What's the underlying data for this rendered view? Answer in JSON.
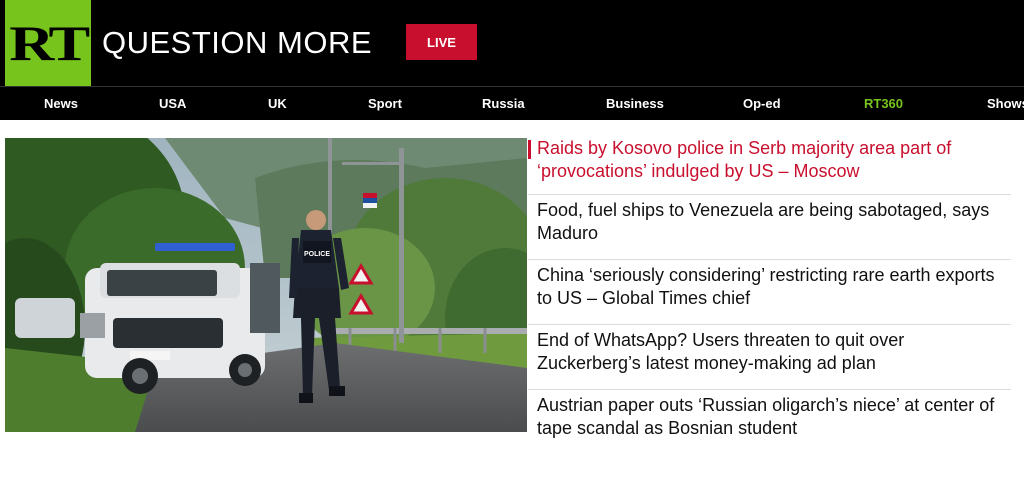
{
  "header": {
    "logo_text": "RT",
    "slogan": "QUESTION MORE",
    "live_label": "LIVE",
    "colors": {
      "brand_green": "#77c41d",
      "live_red": "#c8102e",
      "background": "#000000"
    }
  },
  "nav": {
    "items": [
      {
        "label": "News"
      },
      {
        "label": "USA"
      },
      {
        "label": "UK"
      },
      {
        "label": "Sport"
      },
      {
        "label": "Russia"
      },
      {
        "label": "Business"
      },
      {
        "label": "Op-ed"
      },
      {
        "label": "RT360"
      },
      {
        "label": "Shows"
      }
    ],
    "highlight_color": "#77c41d"
  },
  "hero": {
    "image_alt": "Kosovo police officer walking beside a police SUV on a roadside",
    "police_text": "POLICE"
  },
  "headlines": [
    {
      "text": "Raids by Kosovo police in Serb majority area part of ‘provocations’ indulged by US – Moscow"
    },
    {
      "text": "Food, fuel ships to Venezuela are being sabotaged, says Maduro"
    },
    {
      "text": "China ‘seriously considering’ restricting rare earth exports to US – Global Times chief"
    },
    {
      "text": "End of WhatsApp? Users threaten to quit over Zuckerberg’s latest money-making ad plan"
    },
    {
      "text": "Austrian paper outs ‘Russian oligarch’s niece’ at center of tape scandal as Bosnian student"
    }
  ]
}
